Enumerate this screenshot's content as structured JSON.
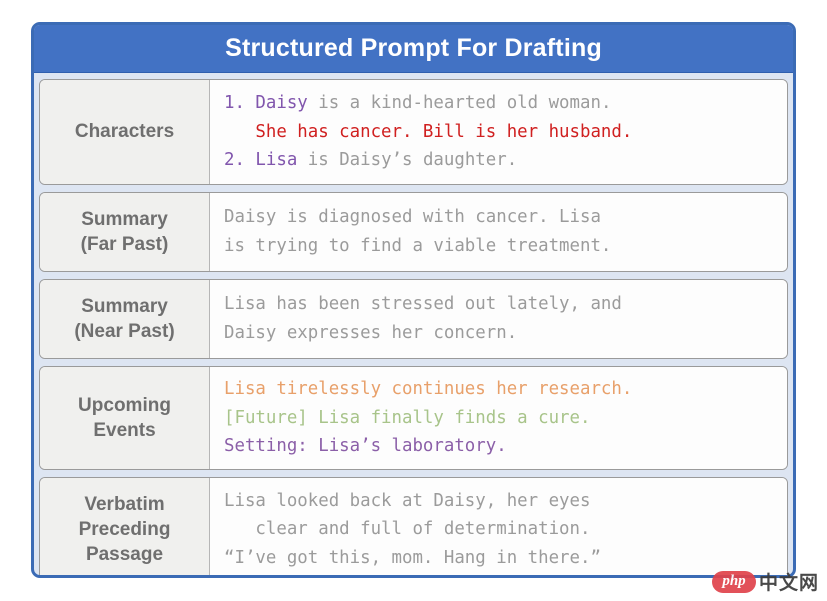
{
  "title": {
    "text": "Structured Prompt For Drafting",
    "bar_color": "#4272c4",
    "text_color": "#ffffff"
  },
  "colors": {
    "panel_border": "#3b6bb5",
    "panel_background": "#dde5f2",
    "label_cell": "#f0f0ee",
    "content_cell": "#fdfdfd",
    "label_text": "#6f6f6f",
    "body_gray": "#9b9b9b",
    "highlight_red": "#d02020",
    "highlight_purple": "#8156ad",
    "highlight_orange": "#e8a06a",
    "highlight_green": "#a8c48a",
    "highlight_violet": "#8b5fa8"
  },
  "rows": [
    {
      "label_lines": [
        "Characters"
      ],
      "lines": [
        [
          {
            "t": "1. ",
            "c": "c-purple"
          },
          {
            "t": "Daisy",
            "c": "c-purple"
          },
          {
            "t": " is a kind-hearted old woman.",
            "c": "c-gray"
          }
        ],
        [
          {
            "t": "   She has cancer. Bill is her husband.",
            "c": "c-red"
          }
        ],
        [
          {
            "t": "2. ",
            "c": "c-purple"
          },
          {
            "t": "Lisa",
            "c": "c-purple"
          },
          {
            "t": " is Daisy’s daughter.",
            "c": "c-gray"
          }
        ]
      ]
    },
    {
      "label_lines": [
        "Summary",
        "(Far Past)"
      ],
      "lines": [
        [
          {
            "t": "Daisy is diagnosed with cancer. Lisa",
            "c": "c-gray"
          }
        ],
        [
          {
            "t": "is trying to find a viable treatment.",
            "c": "c-gray"
          }
        ]
      ]
    },
    {
      "label_lines": [
        "Summary",
        "(Near Past)"
      ],
      "lines": [
        [
          {
            "t": "Lisa has been stressed out lately, and",
            "c": "c-gray"
          }
        ],
        [
          {
            "t": "Daisy expresses her concern.",
            "c": "c-gray"
          }
        ]
      ]
    },
    {
      "label_lines": [
        "Upcoming",
        "Events"
      ],
      "lines": [
        [
          {
            "t": "Lisa tirelessly continues her research.",
            "c": "c-orange"
          }
        ],
        [
          {
            "t": "[Future] Lisa finally finds a cure.",
            "c": "c-green"
          }
        ],
        [
          {
            "t": "Setting: Lisa’s laboratory.",
            "c": "c-violet"
          }
        ]
      ]
    },
    {
      "label_lines": [
        "Verbatim",
        "Preceding",
        "Passage"
      ],
      "lines": [
        [
          {
            "t": "Lisa looked back at Daisy, her eyes",
            "c": "c-gray"
          }
        ],
        [
          {
            "t": "   clear and full of determination.",
            "c": "c-gray"
          }
        ],
        [
          {
            "t": "“I’ve got this, mom. Hang in there.”",
            "c": "c-gray"
          }
        ]
      ]
    }
  ],
  "watermark": {
    "logo_text": "php",
    "site_text": "中文网"
  }
}
